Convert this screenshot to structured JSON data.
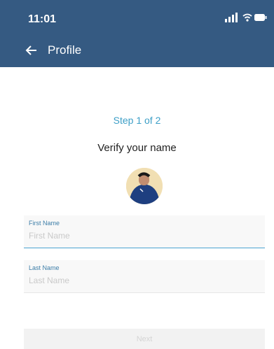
{
  "status_bar": {
    "time": "11:01"
  },
  "nav": {
    "title": "Profile"
  },
  "content": {
    "step": "Step 1 of 2",
    "heading": "Verify your name"
  },
  "fields": {
    "first_name": {
      "label": "First Name",
      "placeholder": "First Name",
      "value": ""
    },
    "last_name": {
      "label": "Last Name",
      "placeholder": "Last Name",
      "value": ""
    }
  },
  "actions": {
    "next": "Next"
  },
  "colors": {
    "header": "#355a82",
    "accent": "#3d9fc7"
  }
}
